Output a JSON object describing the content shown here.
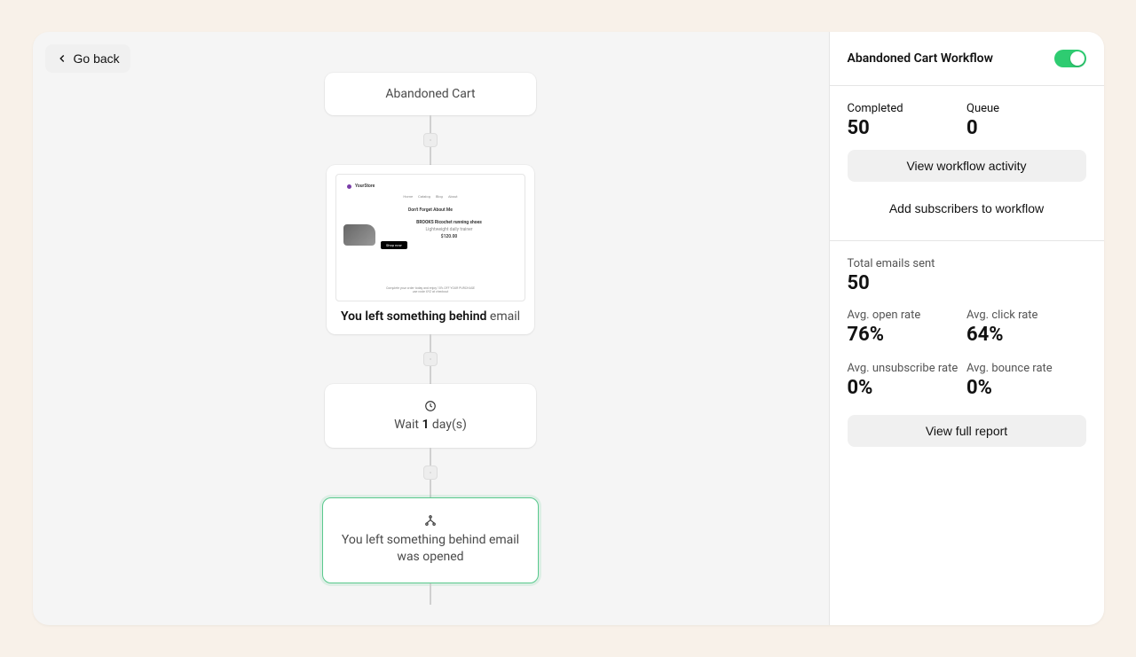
{
  "go_back": "Go back",
  "flow": {
    "trigger": "Abandoned Cart",
    "email": {
      "thumb": {
        "brand": "YourStore",
        "nav": [
          "Home",
          "Catalog",
          "Blog",
          "About"
        ],
        "headline": "Don't Forget About Me",
        "product_name": "BROOKS Ricochet running shoes",
        "product_desc": "Lightweight daily trainer",
        "price": "$120.00",
        "cta": "Shop now",
        "footer_line1": "Complete your order today and enjoy 10% OFF YOUR PURCHASE",
        "footer_line2": "use code XYZ at checkout"
      },
      "title_strong": "You left something behind",
      "title_suffix": " email"
    },
    "wait": {
      "prefix": "Wait ",
      "days": "1",
      "suffix": " day(s)"
    },
    "condition": "You left something behind email was opened"
  },
  "sidebar": {
    "title": "Abandoned Cart Workflow",
    "toggle_on": true,
    "completed_label": "Completed",
    "completed_value": "50",
    "queue_label": "Queue",
    "queue_value": "0",
    "view_activity": "View workflow activity",
    "add_subs": "Add subscribers to workflow",
    "total_sent_label": "Total emails sent",
    "total_sent_value": "50",
    "open_label": "Avg. open rate",
    "open_value": "76%",
    "click_label": "Avg. click rate",
    "click_value": "64%",
    "unsub_label": "Avg. unsubscribe rate",
    "unsub_value": "0%",
    "bounce_label": "Avg. bounce rate",
    "bounce_value": "0%",
    "view_report": "View full report"
  }
}
